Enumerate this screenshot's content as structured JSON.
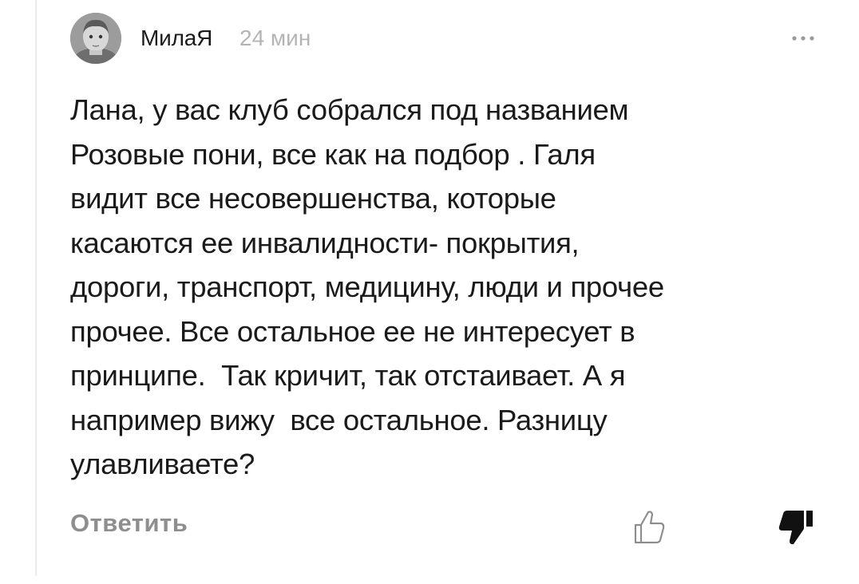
{
  "comment": {
    "author": "МилаЯ",
    "time": "24 мин",
    "text": "Лана, у вас клуб собрался под названием\nРозовые пони, все как на подбор . Галя\nвидит все несовершенства, которые\nкасаются ее инвалидности- покрытия,\nдороги, транспорт, медицину, люди и прочее\nпрочее. Все остальное ее не интересует в\nпринципе.  Так кричит, так отстаивает. А я\nнапример вижу  все остальное. Разницу\nулавливаете?",
    "reply_label": "Ответить",
    "icons": {
      "more": "more-dots-icon",
      "like": "thumb-up-outline-icon",
      "dislike": "thumb-down-filled-icon"
    }
  },
  "colors": {
    "text": "#1a1a1a",
    "muted": "#b4b4b4",
    "reply": "#8e8e8e",
    "thread_line": "#ececec"
  }
}
